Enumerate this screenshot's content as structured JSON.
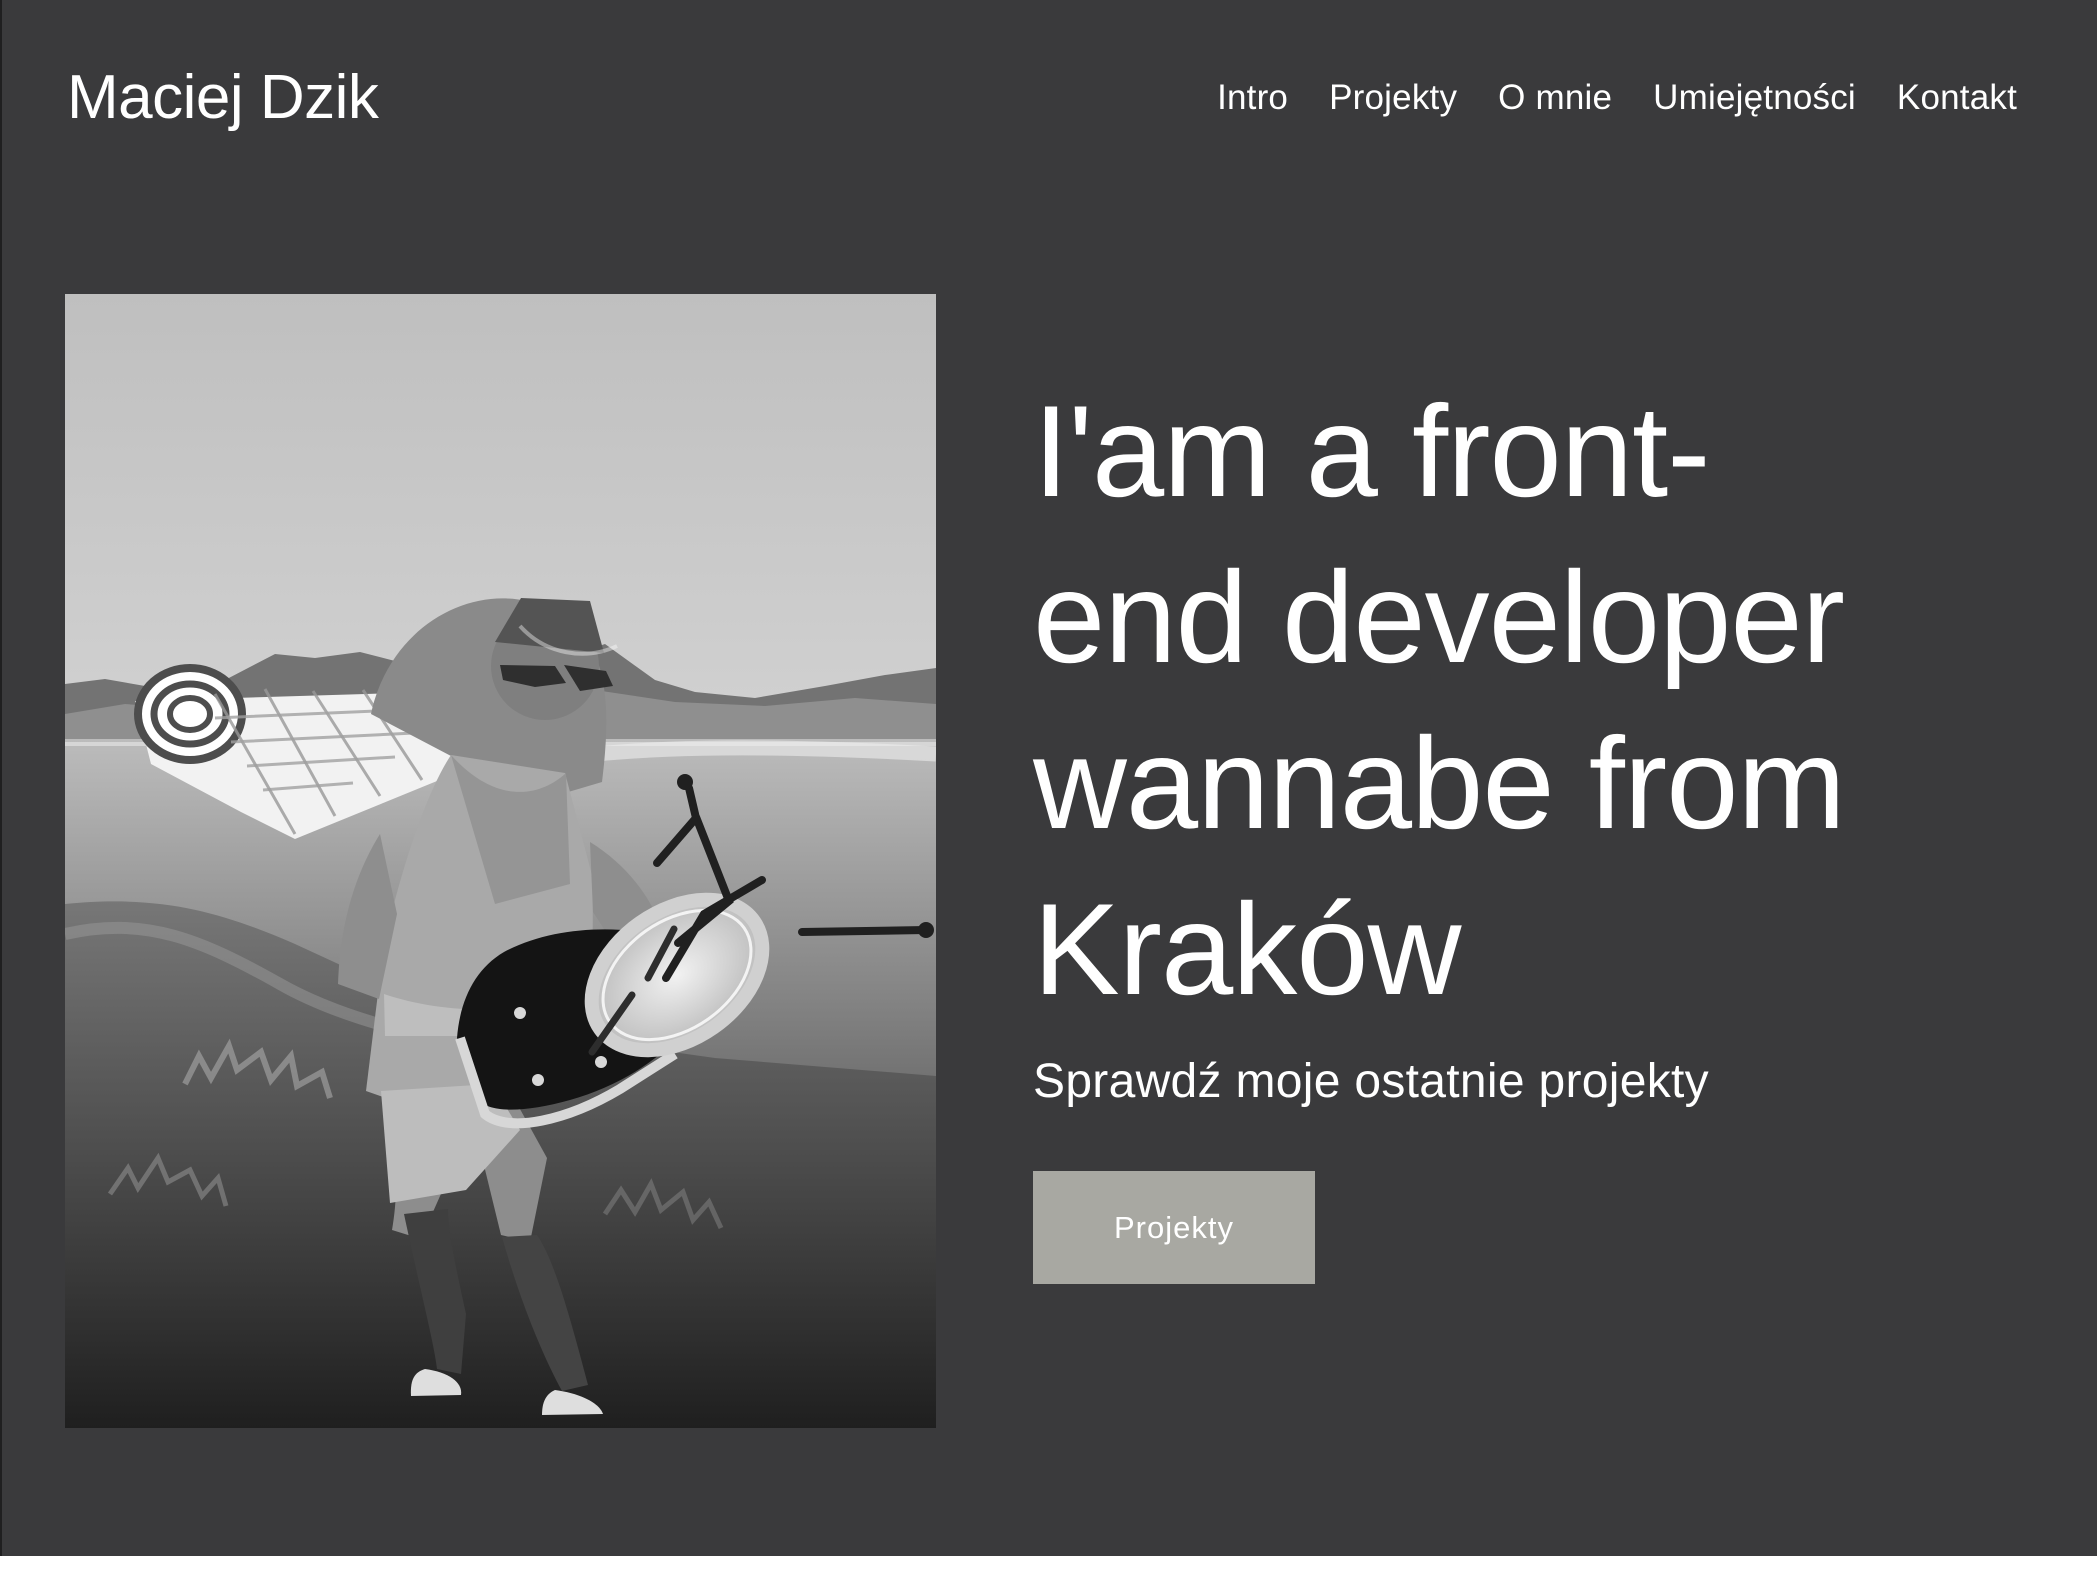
{
  "header": {
    "brand": "Maciej Dzik",
    "nav": [
      {
        "label": "Intro"
      },
      {
        "label": "Projekty"
      },
      {
        "label": "O mnie"
      },
      {
        "label": "Umiejętności"
      },
      {
        "label": "Kontakt"
      }
    ]
  },
  "hero": {
    "headline": "I'am a front-end developer wannabe from Kraków",
    "subline": "Sprawdź moje ostatnie projekty",
    "cta_label": "Projekty"
  },
  "colors": {
    "background": "#3a3a3c",
    "text": "#ffffff",
    "button": "#a8a8a2"
  },
  "icons": []
}
